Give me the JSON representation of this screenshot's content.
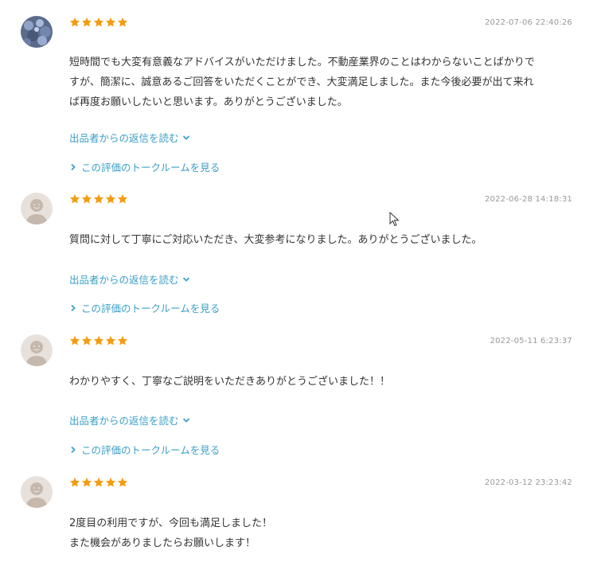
{
  "colors": {
    "star": "#f39c12",
    "link": "#3a9fc7",
    "date": "#999999",
    "text": "#333333"
  },
  "reviews": [
    {
      "rating": 5,
      "date": "2022-07-06 22:40:26",
      "avatar": "photo-avatar",
      "body": [
        "短時間でも大変有意義なアドバイスがいただけました。不動産業界のことはわからないことばかりで",
        "すが、簡潔に、誠意あるご回答をいただくことができ、大変満足しました。また今後必要が出て来れ",
        "ば再度お願いしたいと思います。ありがとうございました。"
      ],
      "reply_link": "出品者からの返信を読む",
      "talk_link": "この評価のトークルームを見る"
    },
    {
      "rating": 5,
      "date": "2022-06-28 14:18:31",
      "avatar": "default-avatar",
      "body": [
        "質問に対して丁寧にご対応いただき、大変参考になりました。ありがとうございました。"
      ],
      "reply_link": "出品者からの返信を読む",
      "talk_link": "この評価のトークルームを見る"
    },
    {
      "rating": 5,
      "date": "2022-05-11 6:23:37",
      "avatar": "default-avatar",
      "body": [
        "わかりやすく、丁寧なご説明をいただきありがとうございました！！"
      ],
      "reply_link": "出品者からの返信を読む",
      "talk_link": "この評価のトークルームを見る"
    },
    {
      "rating": 5,
      "date": "2022-03-12 23:23:42",
      "avatar": "default-avatar",
      "body": [
        "2度目の利用ですが、今回も満足しました！",
        "また機会がありましたらお願いします！"
      ]
    }
  ]
}
